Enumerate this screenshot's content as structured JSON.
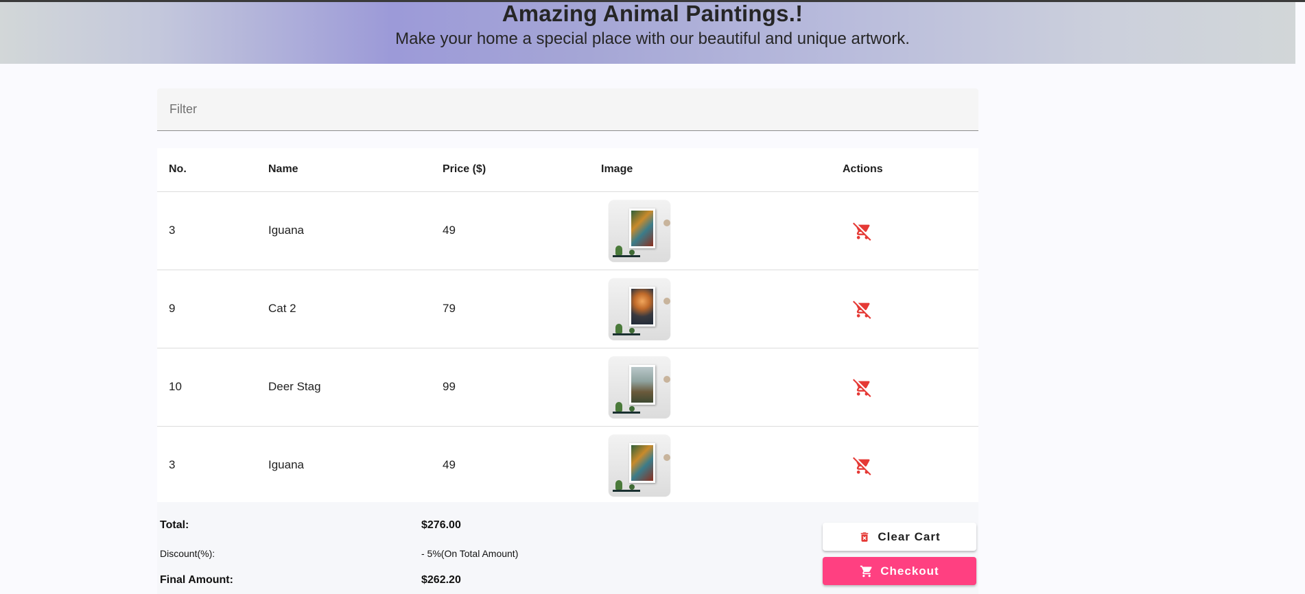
{
  "header": {
    "title": "Amazing Animal Paintings.!",
    "subtitle": "Make your home a special place with our beautiful and unique artwork."
  },
  "filter": {
    "placeholder": "Filter",
    "value": ""
  },
  "table": {
    "columns": [
      "No.",
      "Name",
      "Price ($)",
      "Image",
      "Actions"
    ],
    "rows": [
      {
        "no": "3",
        "name": "Iguana",
        "price": "49"
      },
      {
        "no": "9",
        "name": "Cat 2",
        "price": "79"
      },
      {
        "no": "10",
        "name": "Deer Stag",
        "price": "99"
      },
      {
        "no": "3",
        "name": "Iguana",
        "price": "49"
      }
    ],
    "action_icon": "remove-shopping-cart-icon"
  },
  "summary": {
    "total_label": "Total:",
    "total_value": "$276.00",
    "discount_label": "Discount(%):",
    "discount_value": "- 5%(On Total Amount)",
    "final_label": "Final Amount:",
    "final_value": "$262.20"
  },
  "buttons": {
    "clear_label": "Clear Cart",
    "checkout_label": "Checkout"
  },
  "colors": {
    "accent_pink": "#ff4081",
    "remove_red": "#e53935"
  }
}
